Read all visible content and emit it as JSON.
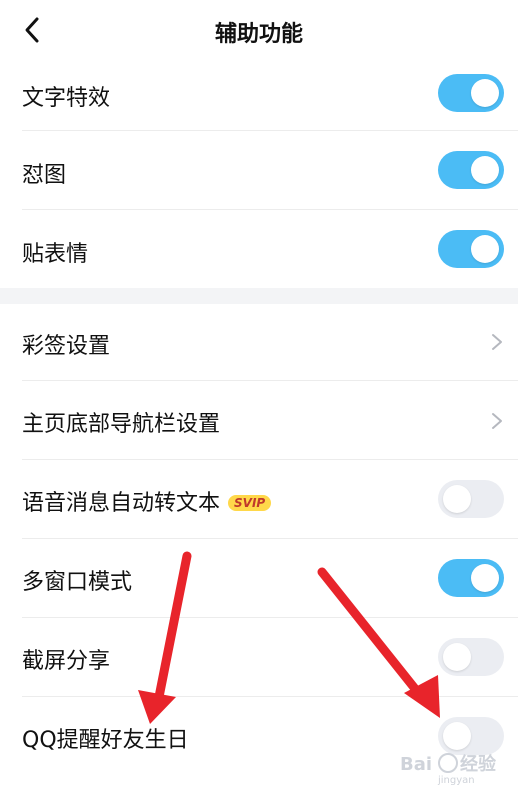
{
  "header": {
    "title": "辅助功能",
    "back_icon": "chevron-left-icon"
  },
  "rows": [
    {
      "label": "文字特效",
      "control": "toggle",
      "state": "on"
    },
    {
      "label": "怼图",
      "control": "toggle",
      "state": "on"
    },
    {
      "label": "贴表情",
      "control": "toggle",
      "state": "on"
    },
    {
      "label": "彩签设置",
      "control": "chevron"
    },
    {
      "label": "主页底部导航栏设置",
      "control": "chevron"
    },
    {
      "label": "语音消息自动转文本",
      "badge": "SVIP",
      "control": "toggle",
      "state": "off"
    },
    {
      "label": "多窗口模式",
      "control": "toggle",
      "state": "on"
    },
    {
      "label": "截屏分享",
      "control": "toggle",
      "state": "off"
    },
    {
      "label": "QQ提醒好友生日",
      "control": "toggle",
      "state": "off"
    }
  ],
  "colors": {
    "toggle_on": "#4bbcf5",
    "toggle_off": "#ebedf2",
    "arrow": "#e8242b",
    "badge_bg": "#ffd84a"
  },
  "watermark": {
    "brand": "Bai",
    "sub": "jingyan"
  }
}
